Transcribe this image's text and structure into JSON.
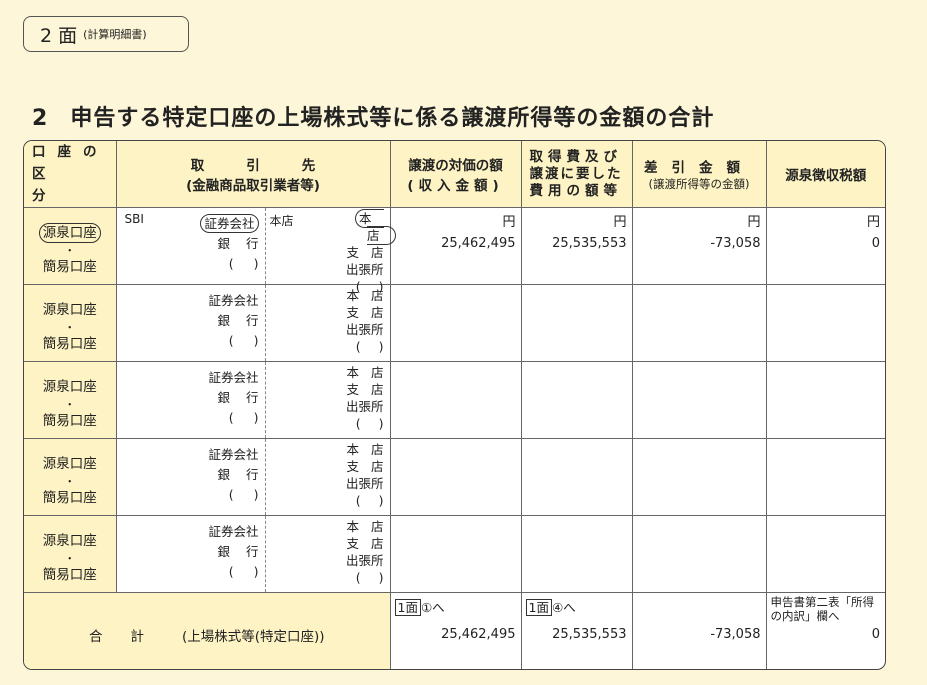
{
  "page_label": {
    "main": "2 面",
    "sub": "(計算明細書)"
  },
  "section": {
    "number": "2",
    "title": "申告する特定口座の上場株式等に係る譲渡所得等の金額の合計"
  },
  "headers": {
    "kubun_line1": "口座の",
    "kubun_line2": "区分",
    "torihiki_line1": "取引先",
    "torihiki_line2": "(金融商品取引業者等)",
    "joto1_line1": "譲渡の対価の額",
    "joto1_line2": "(収入金額)",
    "joto2_line1": "取得費及び",
    "joto2_line2": "譲渡に要した",
    "joto2_line3": "費用の額等",
    "sashi_line1": "差引金額",
    "sashi_line2": "(譲渡所得等の金額)",
    "gensen": "源泉徴収税額"
  },
  "labels": {
    "gensen_koza": "源泉口座",
    "dot": "・",
    "kani_koza": "簡易口座",
    "shoken": "証券会社",
    "ginko": "銀行",
    "paren": "()",
    "honten": "本店",
    "shiten": "支店",
    "shucchojo": "出張所",
    "yen": "円"
  },
  "rows": [
    {
      "company": "SBI",
      "branch": "本店",
      "proceeds": "25,462,495",
      "cost": "25,535,553",
      "diff": "-73,058",
      "tax": "0"
    },
    {},
    {},
    {},
    {}
  ],
  "total": {
    "label_gou": "合計",
    "label_rest": "(上場株式等(特定口座))",
    "ref1_box": "1面",
    "ref1_rest": "①へ",
    "ref2_box": "1面",
    "ref2_rest": "④へ",
    "ref_note": "申告書第二表「所得の内訳」欄へ",
    "proceeds": "25,462,495",
    "cost": "25,535,553",
    "diff": "-73,058",
    "tax": "0"
  }
}
